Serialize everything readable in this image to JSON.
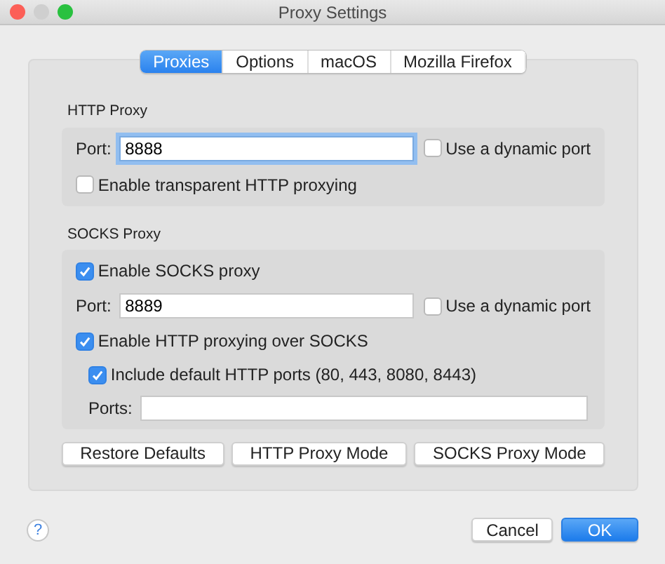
{
  "window": {
    "title": "Proxy Settings"
  },
  "tabs": [
    {
      "label": "Proxies",
      "selected": true
    },
    {
      "label": "Options",
      "selected": false
    },
    {
      "label": "macOS",
      "selected": false
    },
    {
      "label": "Mozilla Firefox",
      "selected": false
    }
  ],
  "http_proxy": {
    "title": "HTTP Proxy",
    "port_label": "Port:",
    "port": "8888",
    "dynamic_port": {
      "label": "Use a dynamic port",
      "checked": false
    },
    "transparent": {
      "label": "Enable transparent HTTP proxying",
      "checked": false
    }
  },
  "socks_proxy": {
    "title": "SOCKS Proxy",
    "enable": {
      "label": "Enable SOCKS proxy",
      "checked": true
    },
    "port_label": "Port:",
    "port": "8889",
    "dynamic_port": {
      "label": "Use a dynamic port",
      "checked": false
    },
    "http_over_socks": {
      "label": "Enable HTTP proxying over SOCKS",
      "checked": true
    },
    "include_default": {
      "label": "Include default HTTP ports (80, 443, 8080, 8443)",
      "checked": true
    },
    "ports_label": "Ports:"
  },
  "mode_buttons": [
    "Restore Defaults",
    "HTTP Proxy Mode",
    "SOCKS Proxy Mode"
  ],
  "help": "?",
  "buttons": [
    {
      "label": "Cancel",
      "kind": "default"
    },
    {
      "label": "OK",
      "kind": "primary"
    }
  ]
}
